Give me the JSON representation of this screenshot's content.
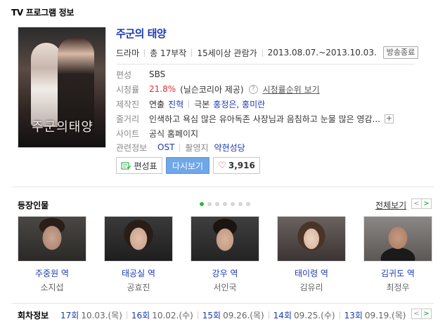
{
  "section_title": "TV 프로그램 정보",
  "program": {
    "poster_title": "주군의태양",
    "title": "주군의 태양",
    "genre": "드라마",
    "episodes": "총 17부작",
    "rating": "15세이상 관람가",
    "period": "2013.08.07.~2013.10.03.",
    "status": "방송종료"
  },
  "details": {
    "broadcaster_label": "편성",
    "broadcaster": "SBS",
    "viewership_label": "시청률",
    "viewership": "21.8%",
    "viewership_source": "(닐슨코리아 제공)",
    "viewership_rank_link": "시청률순위 보기",
    "production_label": "제작진",
    "director_label": "연출",
    "director": "진혁",
    "writer_label": "극본",
    "writer": "홍정은, 홍미란",
    "synopsis_label": "줄거리",
    "synopsis": "인색하고 욕심 많은 유아독존 사장님과 음침하고 눈물 많은 영감...",
    "site_label": "사이트",
    "site": "공식 홈페이지",
    "related_label": "관련정보",
    "ost": "OST",
    "location_label": "촬영지",
    "location": "약현성당"
  },
  "buttons": {
    "schedule": "편성표",
    "replay": "다시보기",
    "likes": "3,916"
  },
  "cast_section": {
    "title": "등장인물",
    "view_all": "전체보기",
    "prev": "<",
    "next": ">",
    "members": [
      {
        "role": "주중원 역",
        "actor": "소지섭"
      },
      {
        "role": "태공실 역",
        "actor": "공효진"
      },
      {
        "role": "강우 역",
        "actor": "서인국"
      },
      {
        "role": "태이령 역",
        "actor": "김유리"
      },
      {
        "role": "김귀도 역",
        "actor": "최정우"
      }
    ]
  },
  "episode_section": {
    "title": "회차정보",
    "prev": "<",
    "next": ">",
    "items": [
      {
        "no": "17회",
        "date": "10.03.(목)"
      },
      {
        "no": "16회",
        "date": "10.02.(수)"
      },
      {
        "no": "15회",
        "date": "09.26.(목)"
      },
      {
        "no": "14회",
        "date": "09.25.(수)"
      },
      {
        "no": "13회",
        "date": "09.19.(목)"
      }
    ]
  },
  "colors": {
    "link_blue": "#1a3ab4",
    "rating_red": "#e62e2e",
    "accent_green": "#35b34a",
    "replay_button": "#6fa7e8"
  }
}
